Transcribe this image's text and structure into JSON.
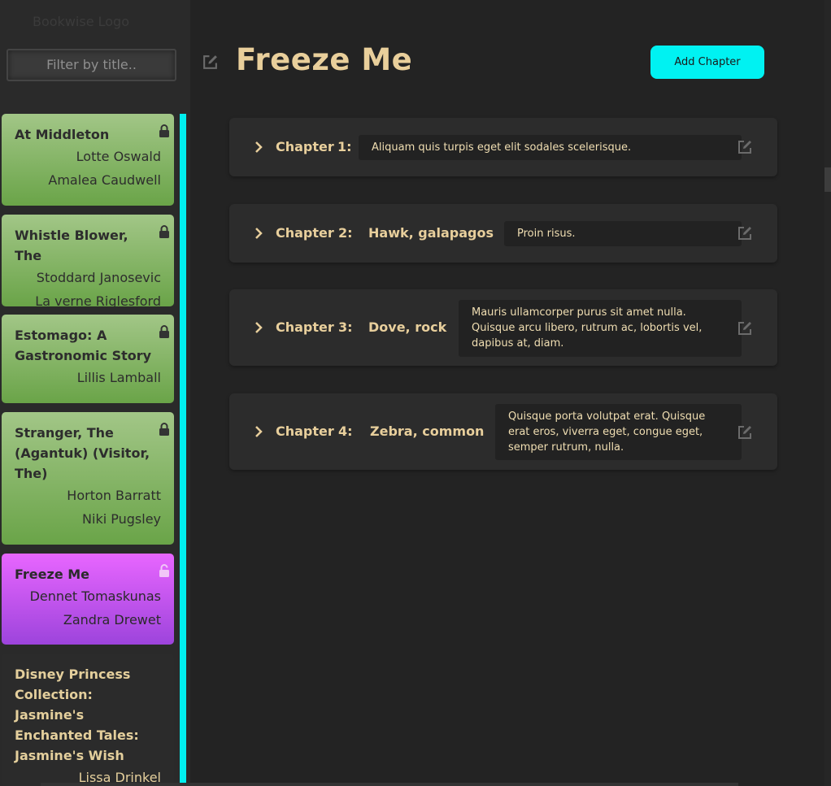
{
  "sidebar": {
    "logo_text": "Bookwise Logo",
    "filter_placeholder": "Filter by title..",
    "books": [
      {
        "title": "At Middleton",
        "authors": [
          "Lotte Oswald",
          "Amalea Caudwell"
        ],
        "locked": true,
        "selected": false
      },
      {
        "title": "Whistle Blower, The",
        "authors": [
          "Stoddard Janosevic",
          "La verne Riglesford"
        ],
        "locked": true,
        "selected": false
      },
      {
        "title": "Estomago: A Gastronomic Story",
        "authors": [
          "Lillis Lamball"
        ],
        "locked": true,
        "selected": false
      },
      {
        "title": "Stranger, The (Agantuk) (Visitor, The)",
        "authors": [
          "Horton Barratt",
          "Niki Pugsley"
        ],
        "locked": true,
        "selected": false
      },
      {
        "title": "Freeze Me",
        "authors": [
          "Dennet Tomaskunas",
          "Zandra Drewet"
        ],
        "locked": false,
        "selected": true
      },
      {
        "title": "Disney Princess Collection: Jasmine's Enchanted Tales: Jasmine's Wish",
        "authors": [
          "Lissa Drinkel"
        ],
        "locked": false,
        "selected": false
      }
    ]
  },
  "main": {
    "book_title": "Freeze Me",
    "add_chapter_label": "Add Chapter",
    "chapter_word": "Chapter",
    "chapters": [
      {
        "number": "1:",
        "name": "",
        "summary": "Aliquam quis turpis eget elit sodales scelerisque."
      },
      {
        "number": "2:",
        "name": "Hawk, galapagos",
        "summary": "Proin risus."
      },
      {
        "number": "3:",
        "name": "Dove, rock",
        "summary": "Mauris ullamcorper purus sit amet nulla. Quisque arcu libero, rutrum ac, lobortis vel, dapibus at, diam."
      },
      {
        "number": "4:",
        "name": "Zebra, common",
        "summary": "Quisque porta volutpat erat. Quisque erat eros, viverra eget, congue eget, semper rutrum, nulla."
      }
    ]
  },
  "icons": {
    "edit": "edit-icon",
    "lock": "lock-icon",
    "unlock": "unlock-icon",
    "chevron": "chevron-right-icon"
  },
  "colors": {
    "accent": "#00f2f2",
    "title_gold": "#e9cf9b",
    "card_green": "#6aa448",
    "card_selected": "#d15fff"
  }
}
